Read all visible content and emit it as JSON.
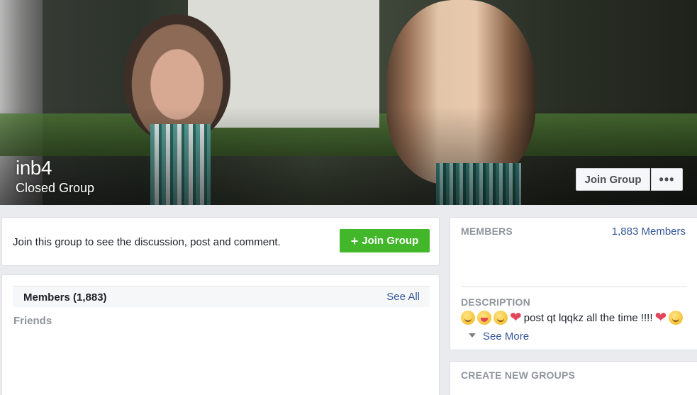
{
  "cover": {
    "group_name": "inb4",
    "group_type": "Closed Group",
    "join_label": "Join Group",
    "more_label": "•••"
  },
  "join_card": {
    "text": "Join this group to see the discussion, post and comment.",
    "button_label": "Join Group",
    "button_color": "#42b72a"
  },
  "members_card": {
    "title": "Members (1,883)",
    "see_all": "See All",
    "friends_label": "Friends"
  },
  "sidebar": {
    "members_heading": "MEMBERS",
    "members_count": "1,883 Members",
    "description_heading": "DESCRIPTION",
    "description_text": "post qt lqqkz all the time !!!!",
    "see_more": "See More",
    "create_heading": "CREATE NEW GROUPS"
  },
  "colors": {
    "link": "#365899",
    "muted": "#90949c",
    "background": "#e9ebee"
  }
}
